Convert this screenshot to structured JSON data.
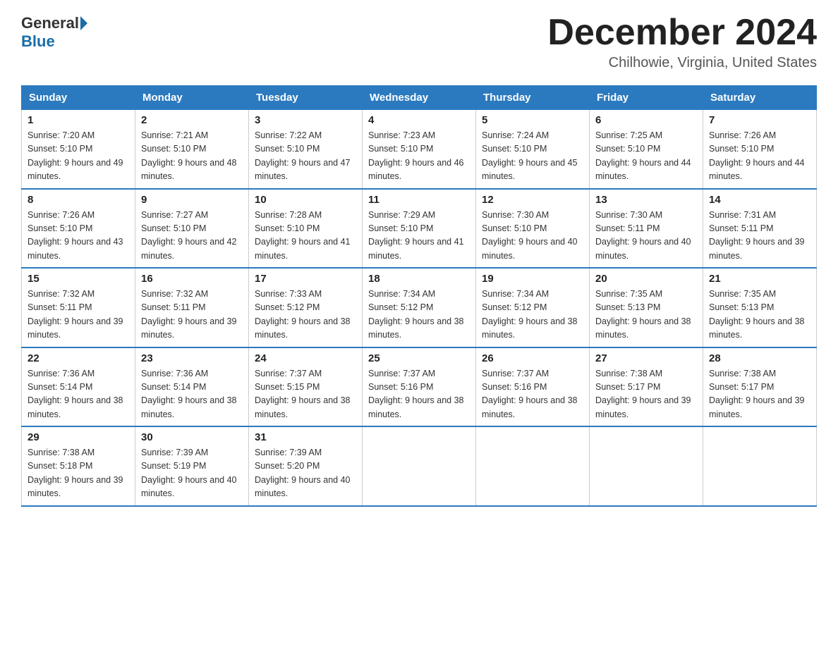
{
  "header": {
    "logo_general": "General",
    "logo_blue": "Blue",
    "month_title": "December 2024",
    "location": "Chilhowie, Virginia, United States"
  },
  "days_of_week": [
    "Sunday",
    "Monday",
    "Tuesday",
    "Wednesday",
    "Thursday",
    "Friday",
    "Saturday"
  ],
  "weeks": [
    [
      {
        "day": "1",
        "sunrise": "7:20 AM",
        "sunset": "5:10 PM",
        "daylight": "9 hours and 49 minutes."
      },
      {
        "day": "2",
        "sunrise": "7:21 AM",
        "sunset": "5:10 PM",
        "daylight": "9 hours and 48 minutes."
      },
      {
        "day": "3",
        "sunrise": "7:22 AM",
        "sunset": "5:10 PM",
        "daylight": "9 hours and 47 minutes."
      },
      {
        "day": "4",
        "sunrise": "7:23 AM",
        "sunset": "5:10 PM",
        "daylight": "9 hours and 46 minutes."
      },
      {
        "day": "5",
        "sunrise": "7:24 AM",
        "sunset": "5:10 PM",
        "daylight": "9 hours and 45 minutes."
      },
      {
        "day": "6",
        "sunrise": "7:25 AM",
        "sunset": "5:10 PM",
        "daylight": "9 hours and 44 minutes."
      },
      {
        "day": "7",
        "sunrise": "7:26 AM",
        "sunset": "5:10 PM",
        "daylight": "9 hours and 44 minutes."
      }
    ],
    [
      {
        "day": "8",
        "sunrise": "7:26 AM",
        "sunset": "5:10 PM",
        "daylight": "9 hours and 43 minutes."
      },
      {
        "day": "9",
        "sunrise": "7:27 AM",
        "sunset": "5:10 PM",
        "daylight": "9 hours and 42 minutes."
      },
      {
        "day": "10",
        "sunrise": "7:28 AM",
        "sunset": "5:10 PM",
        "daylight": "9 hours and 41 minutes."
      },
      {
        "day": "11",
        "sunrise": "7:29 AM",
        "sunset": "5:10 PM",
        "daylight": "9 hours and 41 minutes."
      },
      {
        "day": "12",
        "sunrise": "7:30 AM",
        "sunset": "5:10 PM",
        "daylight": "9 hours and 40 minutes."
      },
      {
        "day": "13",
        "sunrise": "7:30 AM",
        "sunset": "5:11 PM",
        "daylight": "9 hours and 40 minutes."
      },
      {
        "day": "14",
        "sunrise": "7:31 AM",
        "sunset": "5:11 PM",
        "daylight": "9 hours and 39 minutes."
      }
    ],
    [
      {
        "day": "15",
        "sunrise": "7:32 AM",
        "sunset": "5:11 PM",
        "daylight": "9 hours and 39 minutes."
      },
      {
        "day": "16",
        "sunrise": "7:32 AM",
        "sunset": "5:11 PM",
        "daylight": "9 hours and 39 minutes."
      },
      {
        "day": "17",
        "sunrise": "7:33 AM",
        "sunset": "5:12 PM",
        "daylight": "9 hours and 38 minutes."
      },
      {
        "day": "18",
        "sunrise": "7:34 AM",
        "sunset": "5:12 PM",
        "daylight": "9 hours and 38 minutes."
      },
      {
        "day": "19",
        "sunrise": "7:34 AM",
        "sunset": "5:12 PM",
        "daylight": "9 hours and 38 minutes."
      },
      {
        "day": "20",
        "sunrise": "7:35 AM",
        "sunset": "5:13 PM",
        "daylight": "9 hours and 38 minutes."
      },
      {
        "day": "21",
        "sunrise": "7:35 AM",
        "sunset": "5:13 PM",
        "daylight": "9 hours and 38 minutes."
      }
    ],
    [
      {
        "day": "22",
        "sunrise": "7:36 AM",
        "sunset": "5:14 PM",
        "daylight": "9 hours and 38 minutes."
      },
      {
        "day": "23",
        "sunrise": "7:36 AM",
        "sunset": "5:14 PM",
        "daylight": "9 hours and 38 minutes."
      },
      {
        "day": "24",
        "sunrise": "7:37 AM",
        "sunset": "5:15 PM",
        "daylight": "9 hours and 38 minutes."
      },
      {
        "day": "25",
        "sunrise": "7:37 AM",
        "sunset": "5:16 PM",
        "daylight": "9 hours and 38 minutes."
      },
      {
        "day": "26",
        "sunrise": "7:37 AM",
        "sunset": "5:16 PM",
        "daylight": "9 hours and 38 minutes."
      },
      {
        "day": "27",
        "sunrise": "7:38 AM",
        "sunset": "5:17 PM",
        "daylight": "9 hours and 39 minutes."
      },
      {
        "day": "28",
        "sunrise": "7:38 AM",
        "sunset": "5:17 PM",
        "daylight": "9 hours and 39 minutes."
      }
    ],
    [
      {
        "day": "29",
        "sunrise": "7:38 AM",
        "sunset": "5:18 PM",
        "daylight": "9 hours and 39 minutes."
      },
      {
        "day": "30",
        "sunrise": "7:39 AM",
        "sunset": "5:19 PM",
        "daylight": "9 hours and 40 minutes."
      },
      {
        "day": "31",
        "sunrise": "7:39 AM",
        "sunset": "5:20 PM",
        "daylight": "9 hours and 40 minutes."
      },
      null,
      null,
      null,
      null
    ]
  ]
}
